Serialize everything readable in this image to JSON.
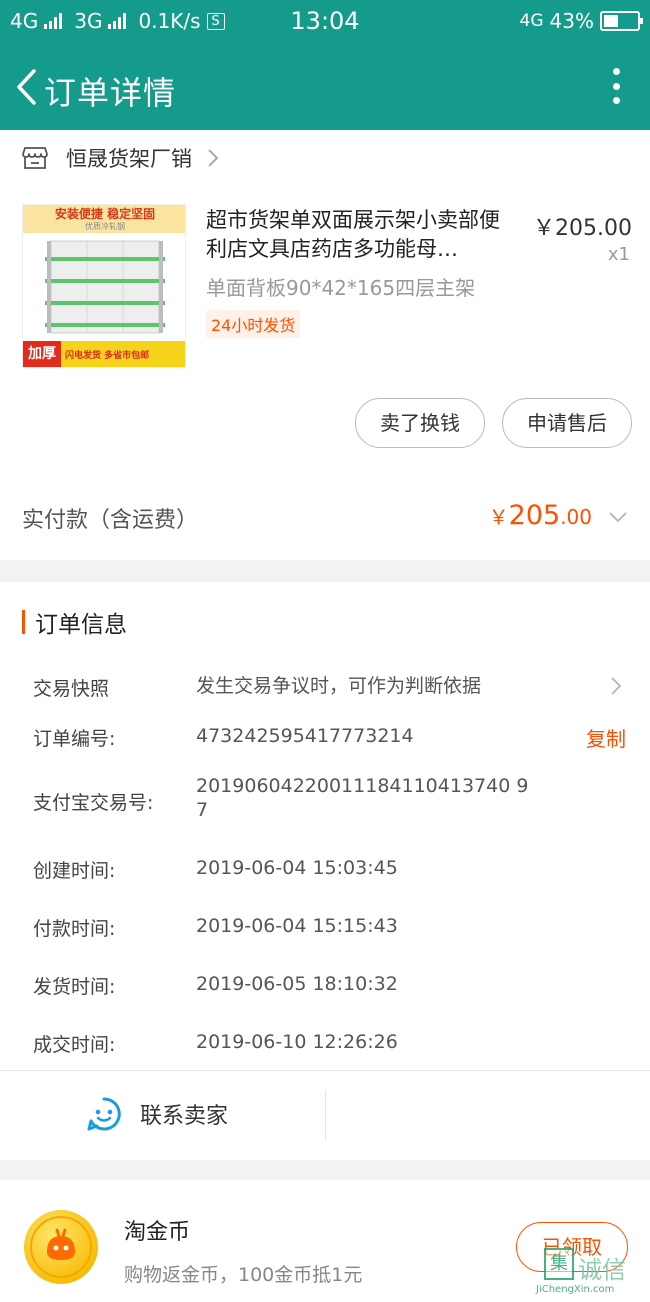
{
  "status_bar": {
    "network1": "4G",
    "network2": "3G",
    "speed": "0.1K/s",
    "s_icon": "S",
    "time": "13:04",
    "network3": "4G",
    "battery": "43%",
    "battery_level": 0.43
  },
  "nav": {
    "title": "订单详情"
  },
  "shop": {
    "name": "恒晟货架厂销"
  },
  "product": {
    "title": "超市货架单双面展示架小卖部便利店文具店药店多功能母…",
    "price": "￥205.00",
    "qty": "x1",
    "spec": "单面背板90*42*165四层主架",
    "badge": "24小时发货",
    "image": {
      "banner": "安装便捷 稳定坚固",
      "banner_sub": "优质冷轧钢",
      "thick": "加厚",
      "tag": "闪电发货 多省市包邮"
    }
  },
  "actions": {
    "sell": "卖了换钱",
    "after_sale": "申请售后"
  },
  "payment": {
    "label": "实付款（含运费）",
    "currency": "￥",
    "amount_int": "205",
    "amount_dec": ".00"
  },
  "order_info": {
    "title": "订单信息",
    "rows": [
      {
        "label": "交易快照",
        "value": "发生交易争议时，可作为判断依据"
      },
      {
        "label": "订单编号:",
        "value": "473242595417773214"
      },
      {
        "label": "支付宝交易号:",
        "value": "20190604220011184110413740 97"
      },
      {
        "label": "创建时间:",
        "value": "2019-06-04 15:03:45"
      },
      {
        "label": "付款时间:",
        "value": "2019-06-04 15:15:43"
      },
      {
        "label": "发货时间:",
        "value": "2019-06-05 18:10:32"
      },
      {
        "label": "成交时间:",
        "value": "2019-06-10 12:26:26"
      }
    ],
    "copy": "复制"
  },
  "contact": {
    "label": "联系卖家"
  },
  "coins": {
    "title": "淘金币",
    "subtitle": "购物返金币，100金币抵1元",
    "button": "已领取"
  },
  "watermark": {
    "char": "集",
    "text": "诚信",
    "url": "JiChengXin.com"
  },
  "colors": {
    "brand": "#159b8b",
    "accent": "#ff5000"
  }
}
